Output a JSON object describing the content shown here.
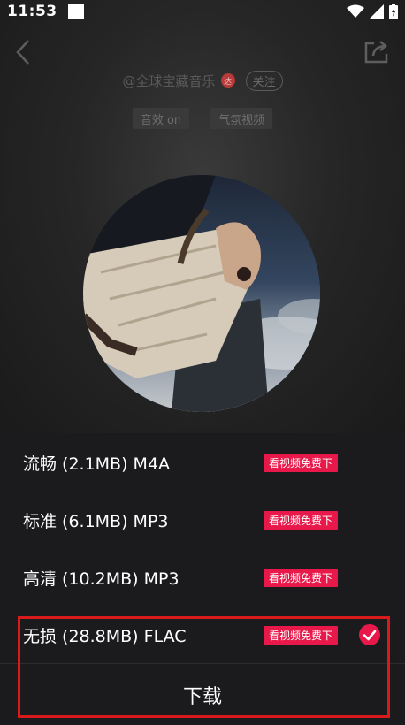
{
  "status_bar": {
    "time": "11:53"
  },
  "header": {
    "artist": "@全球宝藏音乐",
    "vip_badge": "达",
    "follow_label": "关注"
  },
  "tags": [
    "音效 on",
    "气氛视频"
  ],
  "options": [
    {
      "label": "流畅 (2.1MB) M4A",
      "badge": "看视频免费下",
      "selected": false
    },
    {
      "label": "标准 (6.1MB) MP3",
      "badge": "看视频免费下",
      "selected": false
    },
    {
      "label": "高清 (10.2MB) MP3",
      "badge": "看视频免费下",
      "selected": false
    },
    {
      "label": "无损 (28.8MB) FLAC",
      "badge": "看视频免费下",
      "selected": true
    }
  ],
  "download_label": "下载",
  "colors": {
    "accent": "#e8194a",
    "highlight_box": "#d91a1a",
    "sheet_bg": "#1b1b1d"
  },
  "icons": {
    "back": "chevron-left-icon",
    "share": "share-icon",
    "check": "check-circle-icon",
    "wifi": "wifi-icon",
    "signal": "signal-icon",
    "battery": "battery-icon"
  }
}
